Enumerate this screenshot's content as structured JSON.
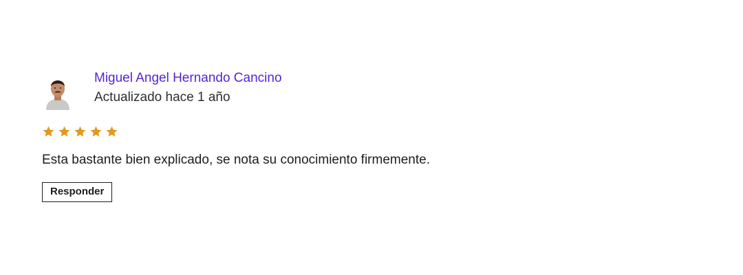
{
  "review": {
    "author": "Miguel Angel Hernando Cancino",
    "updated": "Actualizado hace 1 año",
    "rating": 5,
    "rating_max": 5,
    "comment": "Esta bastante bien explicado, se nota su conocimiento firmemente.",
    "reply_label": "Responder"
  },
  "colors": {
    "author_link": "#5624d0",
    "star": "#e59819",
    "text": "#1c1d1f"
  },
  "icons": {
    "avatar": "user-photo",
    "star": "star-icon"
  }
}
